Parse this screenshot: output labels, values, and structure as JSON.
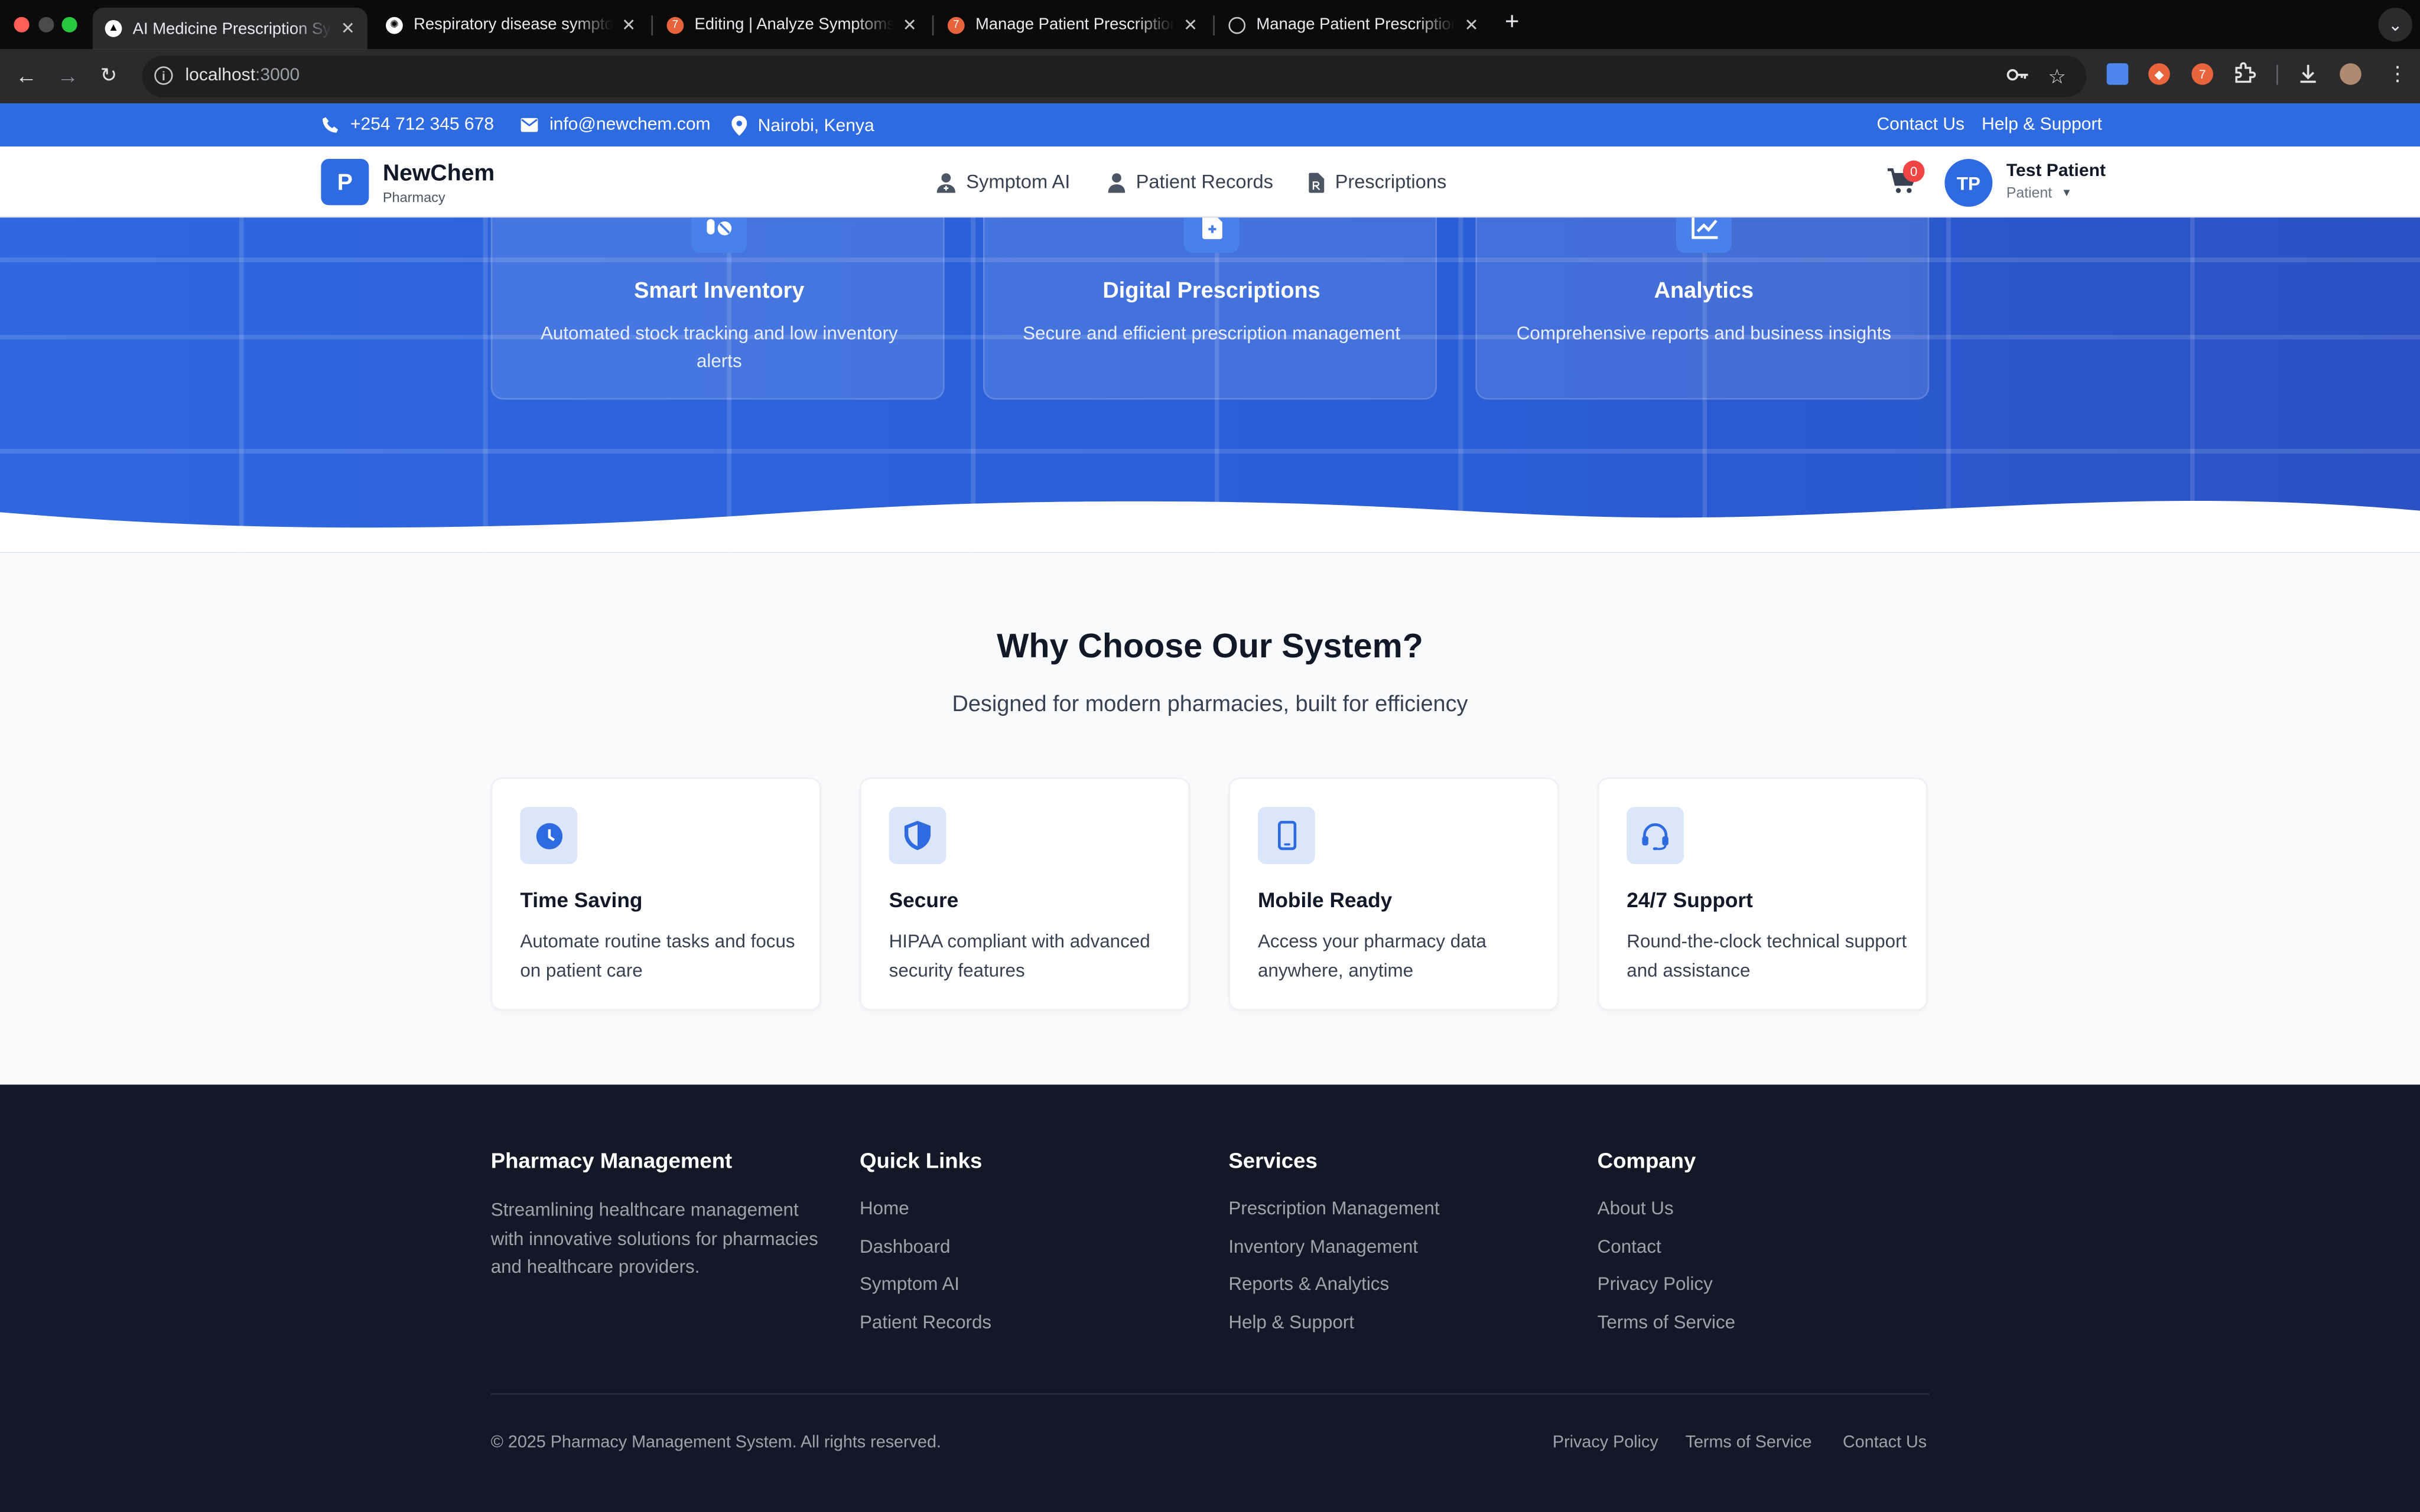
{
  "browser": {
    "tabs": [
      {
        "title": "AI Medicine Prescription System",
        "active": true
      },
      {
        "title": "Respiratory disease symptoms",
        "active": false
      },
      {
        "title": "Editing | Analyze Symptoms for",
        "active": false
      },
      {
        "title": "Manage Patient Prescriptions",
        "active": false
      },
      {
        "title": "Manage Patient Prescriptions",
        "active": false
      }
    ],
    "url_host": "localhost",
    "url_port": ":3000"
  },
  "topbar": {
    "phone": "+254 712 345 678",
    "email": "info@newchem.com",
    "location": "Nairobi, Kenya",
    "contact": "Contact Us",
    "help": "Help & Support"
  },
  "header": {
    "logo_letter": "P",
    "brand": "NewChem",
    "brand_sub": "Pharmacy",
    "nav": [
      "Symptom AI",
      "Patient Records",
      "Prescriptions"
    ],
    "cart_count": "0",
    "avatar_initials": "TP",
    "user_name": "Test Patient",
    "user_role": "Patient"
  },
  "hero_cards": [
    {
      "title": "Smart Inventory",
      "text": "Automated stock tracking and low inventory alerts",
      "icon": "pills-icon"
    },
    {
      "title": "Digital Prescriptions",
      "text": "Secure and efficient prescription management",
      "icon": "prescription-file-icon"
    },
    {
      "title": "Analytics",
      "text": "Comprehensive reports and business insights",
      "icon": "chart-icon"
    }
  ],
  "why": {
    "title": "Why Choose Our System?",
    "subtitle": "Designed for modern pharmacies, built for efficiency",
    "features": [
      {
        "title": "Time Saving",
        "text": "Automate routine tasks and focus on patient care",
        "icon": "clock-icon"
      },
      {
        "title": "Secure",
        "text": "HIPAA compliant with advanced security features",
        "icon": "shield-icon"
      },
      {
        "title": "Mobile Ready",
        "text": "Access your pharmacy data anywhere, anytime",
        "icon": "mobile-icon"
      },
      {
        "title": "24/7 Support",
        "text": "Round-the-clock technical support and assistance",
        "icon": "headset-icon"
      }
    ]
  },
  "footer": {
    "about_title": "Pharmacy Management",
    "about_text": "Streamlining healthcare management with innovative solutions for pharmacies and healthcare providers.",
    "quick_title": "Quick Links",
    "quick_links": [
      "Home",
      "Dashboard",
      "Symptom AI",
      "Patient Records"
    ],
    "services_title": "Services",
    "services_links": [
      "Prescription Management",
      "Inventory Management",
      "Reports & Analytics",
      "Help & Support"
    ],
    "company_title": "Company",
    "company_links": [
      "About Us",
      "Contact",
      "Privacy Policy",
      "Terms of Service"
    ],
    "copyright": "© 2025 Pharmacy Management System. All rights reserved.",
    "bottom_links": [
      "Privacy Policy",
      "Terms of Service",
      "Contact Us"
    ]
  },
  "colors": {
    "primary": "#2f6be0",
    "footer_bg": "#131826",
    "badge": "#ef4444"
  }
}
